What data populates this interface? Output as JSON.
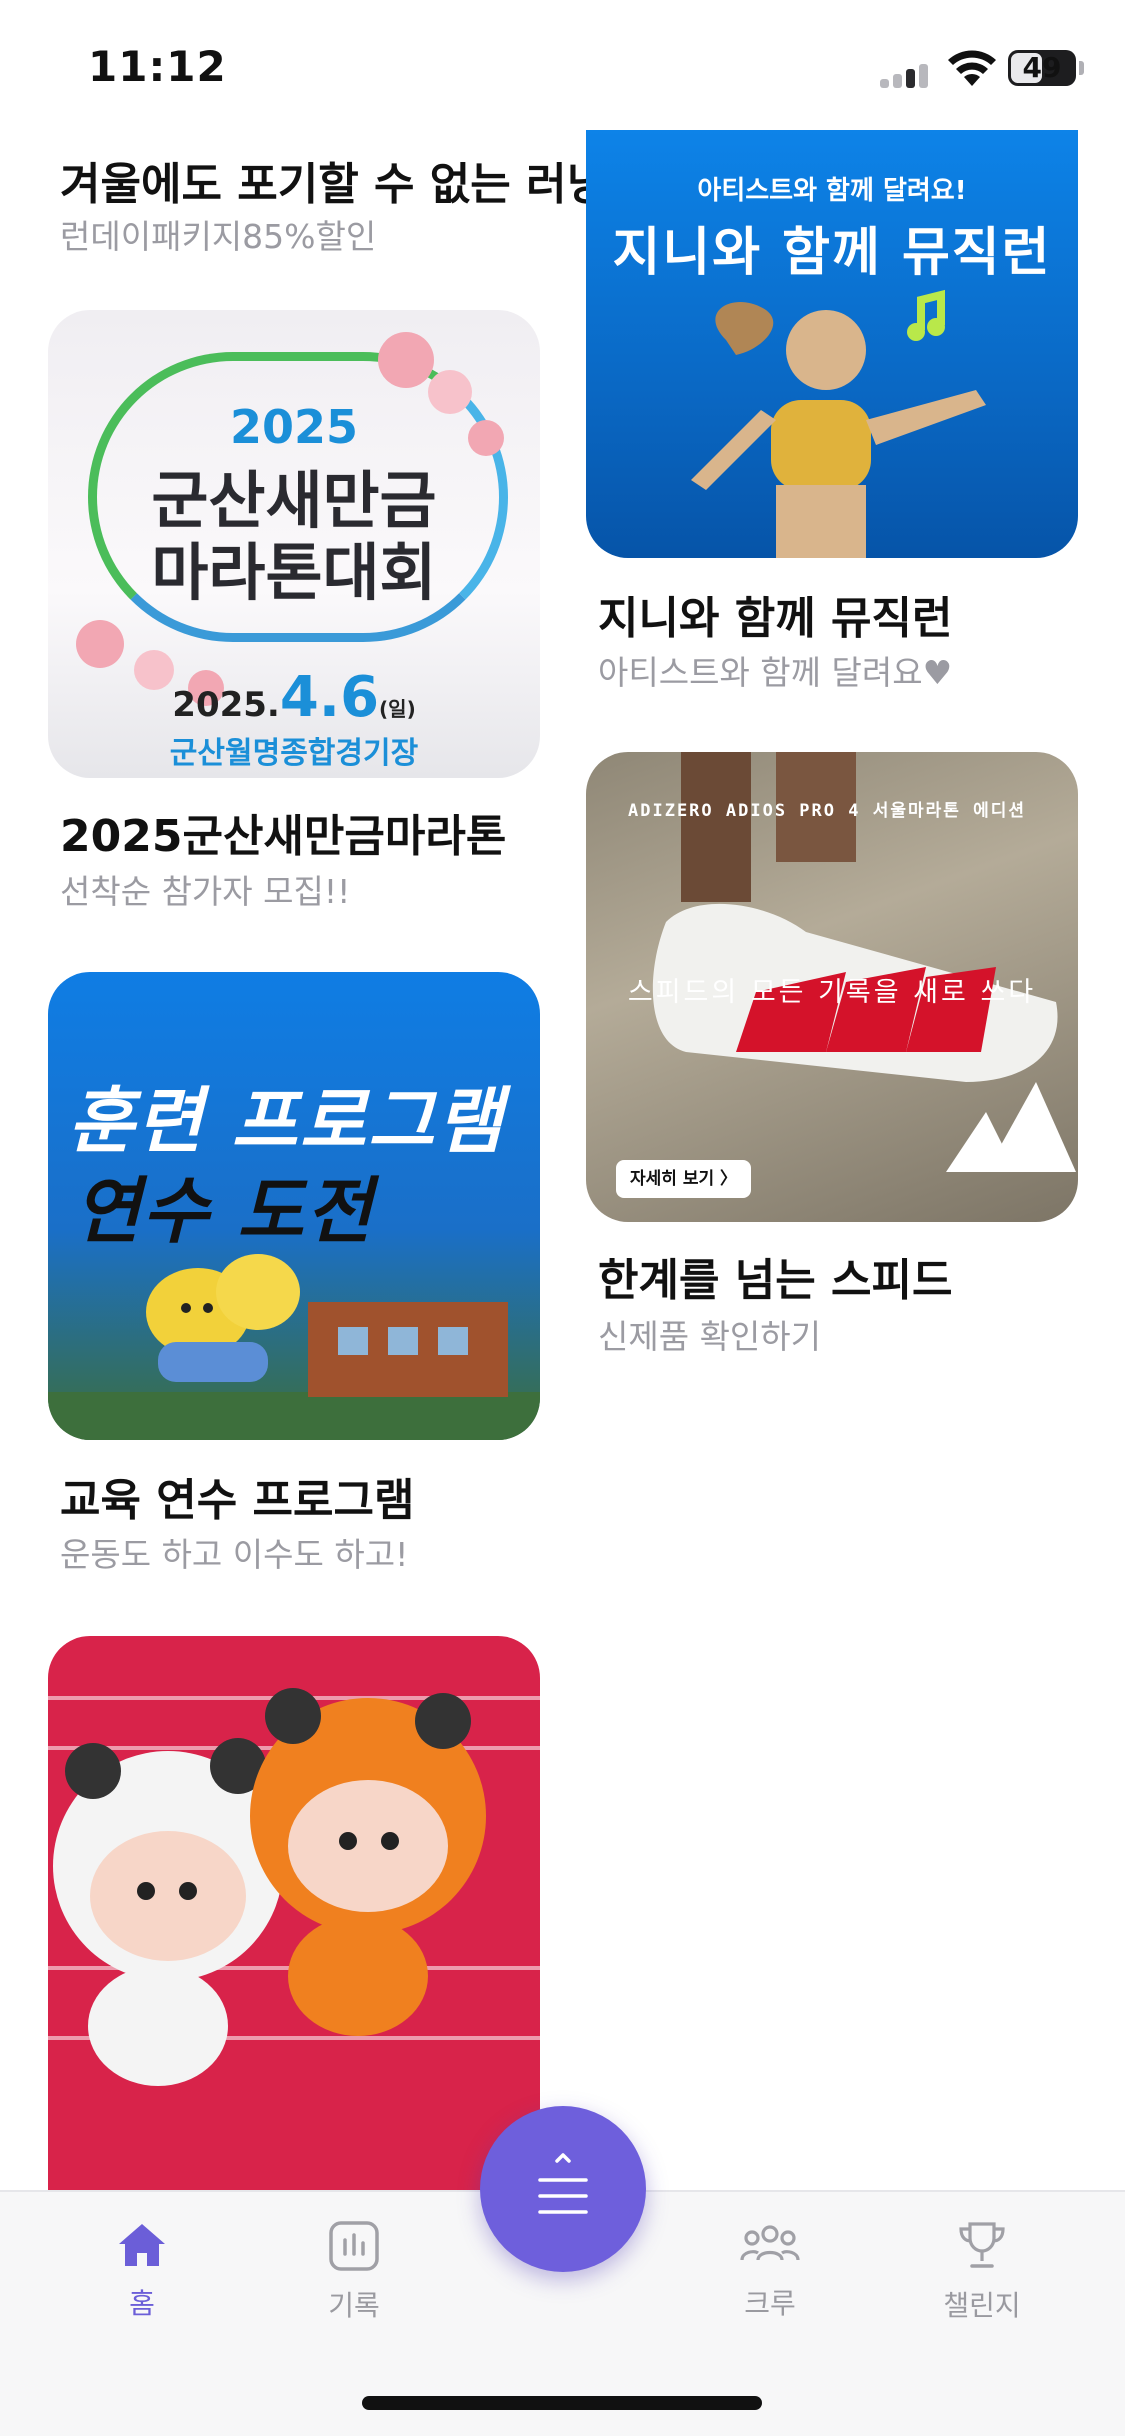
{
  "status_bar": {
    "time": "11:12",
    "battery": "49"
  },
  "feed": {
    "cards": [
      {
        "title": "겨울에도 포기할 수 없는 러닝",
        "subtitle": "런데이패키지85%할인"
      },
      {
        "title": "2025군산새만금마라톤",
        "subtitle": "선착순 참가자 모집!!",
        "image": {
          "year": "2025",
          "line1": "군산새만금",
          "line2": "마라톤대회",
          "date_prefix": "2025.",
          "date_main": "4.6",
          "date_day": "(일)",
          "venue": "군산월명종합경기장"
        }
      },
      {
        "title": "교육 연수 프로그램",
        "subtitle": "운동도 하고 이수도 하고!",
        "image": {
          "line1": "훈련 프로그램",
          "line2": "연수 도전"
        }
      },
      {
        "title": "지니와 함께 뮤직런",
        "subtitle": "아티스트와 함께 달려요♥",
        "image": {
          "sub": "아티스트와 함께 달려요!",
          "head": "지니와 함께 뮤직런"
        }
      },
      {
        "title": "한계를 넘는 스피드",
        "subtitle": "신제품 확인하기",
        "image": {
          "top": "ADIZERO ADIOS PRO 4 서울마라톤 에디션",
          "middle": "스피드의 모든 기록을 새로 쓰다",
          "button": "자세히 보기 〉"
        }
      }
    ]
  },
  "bottom_nav": {
    "items": [
      {
        "label": "홈",
        "icon": "home-icon"
      },
      {
        "label": "기록",
        "icon": "chart-icon"
      },
      {
        "label": "크루",
        "icon": "crew-icon"
      },
      {
        "label": "챌린지",
        "icon": "trophy-icon"
      }
    ],
    "fab_icon": "menu-icon"
  },
  "colors": {
    "accent": "#6e5fdc",
    "muted_text": "#9b9ba2",
    "nav_inactive": "#9a9aa0"
  }
}
